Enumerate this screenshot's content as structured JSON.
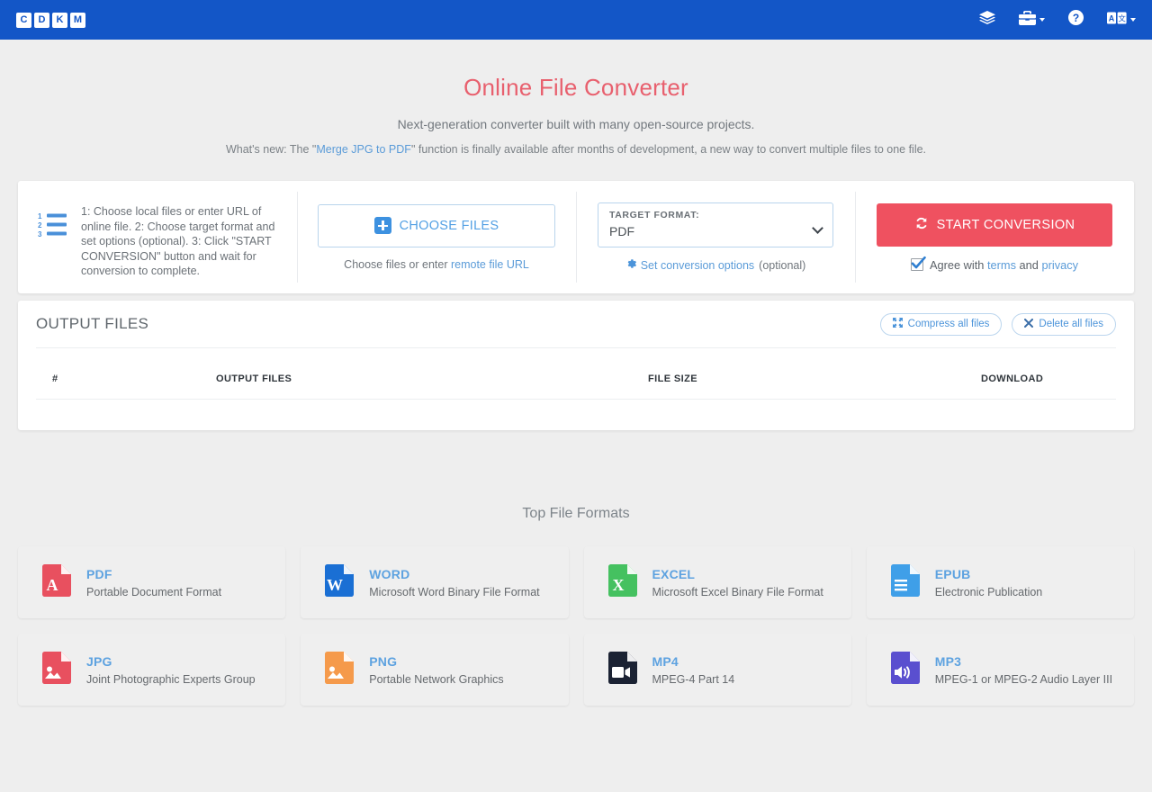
{
  "header": {
    "logo_letters": [
      "C",
      "D",
      "K",
      "M"
    ],
    "nav": [
      {
        "name": "layers-icon",
        "label": "",
        "caret": false
      },
      {
        "name": "toolbox-icon",
        "label": "",
        "caret": true
      },
      {
        "name": "help-circle-icon",
        "label": "",
        "caret": false
      },
      {
        "name": "language-icon",
        "label": "",
        "caret": true
      }
    ]
  },
  "hero": {
    "title": "Online File Converter",
    "subtitle": "Next-generation converter built with many open-source projects.",
    "news_prefix": "What's new: The \"",
    "news_link": "Merge JPG to PDF",
    "news_suffix": "\" function is finally available after months of development, a new way to convert multiple files to one file."
  },
  "converter": {
    "steps_text": "1: Choose local files or enter URL of online file. 2: Choose target format and set options (optional). 3: Click \"START CONVERSION\" button and wait for conversion to complete.",
    "choose_files_label": "CHOOSE FILES",
    "choose_note_prefix": "Choose files or enter ",
    "choose_note_link": "remote file URL",
    "target_format_label": "TARGET FORMAT:",
    "target_format_value": "PDF",
    "options_link": "Set conversion options",
    "options_optional": "(optional)",
    "start_label": "START CONVERSION",
    "agree_prefix": "Agree with ",
    "agree_terms": "terms",
    "agree_and": " and ",
    "agree_privacy": "privacy",
    "agree_checked": true
  },
  "output": {
    "title": "OUTPUT FILES",
    "compress_label": "Compress all files",
    "delete_label": "Delete all files",
    "columns": [
      "#",
      "OUTPUT FILES",
      "FILE SIZE",
      "DOWNLOAD"
    ],
    "rows": []
  },
  "formats": {
    "title": "Top File Formats",
    "items": [
      {
        "name": "PDF",
        "desc": "Portable Document Format",
        "icon": "pdf-file-icon",
        "color": "#e8505f"
      },
      {
        "name": "WORD",
        "desc": "Microsoft Word Binary File Format",
        "icon": "word-file-icon",
        "color": "#1a6fd4"
      },
      {
        "name": "EXCEL",
        "desc": "Microsoft Excel Binary File Format",
        "icon": "excel-file-icon",
        "color": "#45c160"
      },
      {
        "name": "EPUB",
        "desc": "Electronic Publication",
        "icon": "epub-file-icon",
        "color": "#3f9fe8"
      },
      {
        "name": "JPG",
        "desc": "Joint Photographic Experts Group",
        "icon": "jpg-file-icon",
        "color": "#e8505f"
      },
      {
        "name": "PNG",
        "desc": "Portable Network Graphics",
        "icon": "png-file-icon",
        "color": "#f59a4b"
      },
      {
        "name": "MP4",
        "desc": "MPEG-4 Part 14",
        "icon": "mp4-file-icon",
        "color": "#1b2233"
      },
      {
        "name": "MP3",
        "desc": "MPEG-1 or MPEG-2 Audio Layer III",
        "icon": "mp3-file-icon",
        "color": "#5a4fcf"
      }
    ]
  },
  "colors": {
    "navbar": "#1356c7",
    "accent_red": "#ef5160",
    "link_blue": "#5a9bd8",
    "page_bg": "#eeeeee"
  }
}
